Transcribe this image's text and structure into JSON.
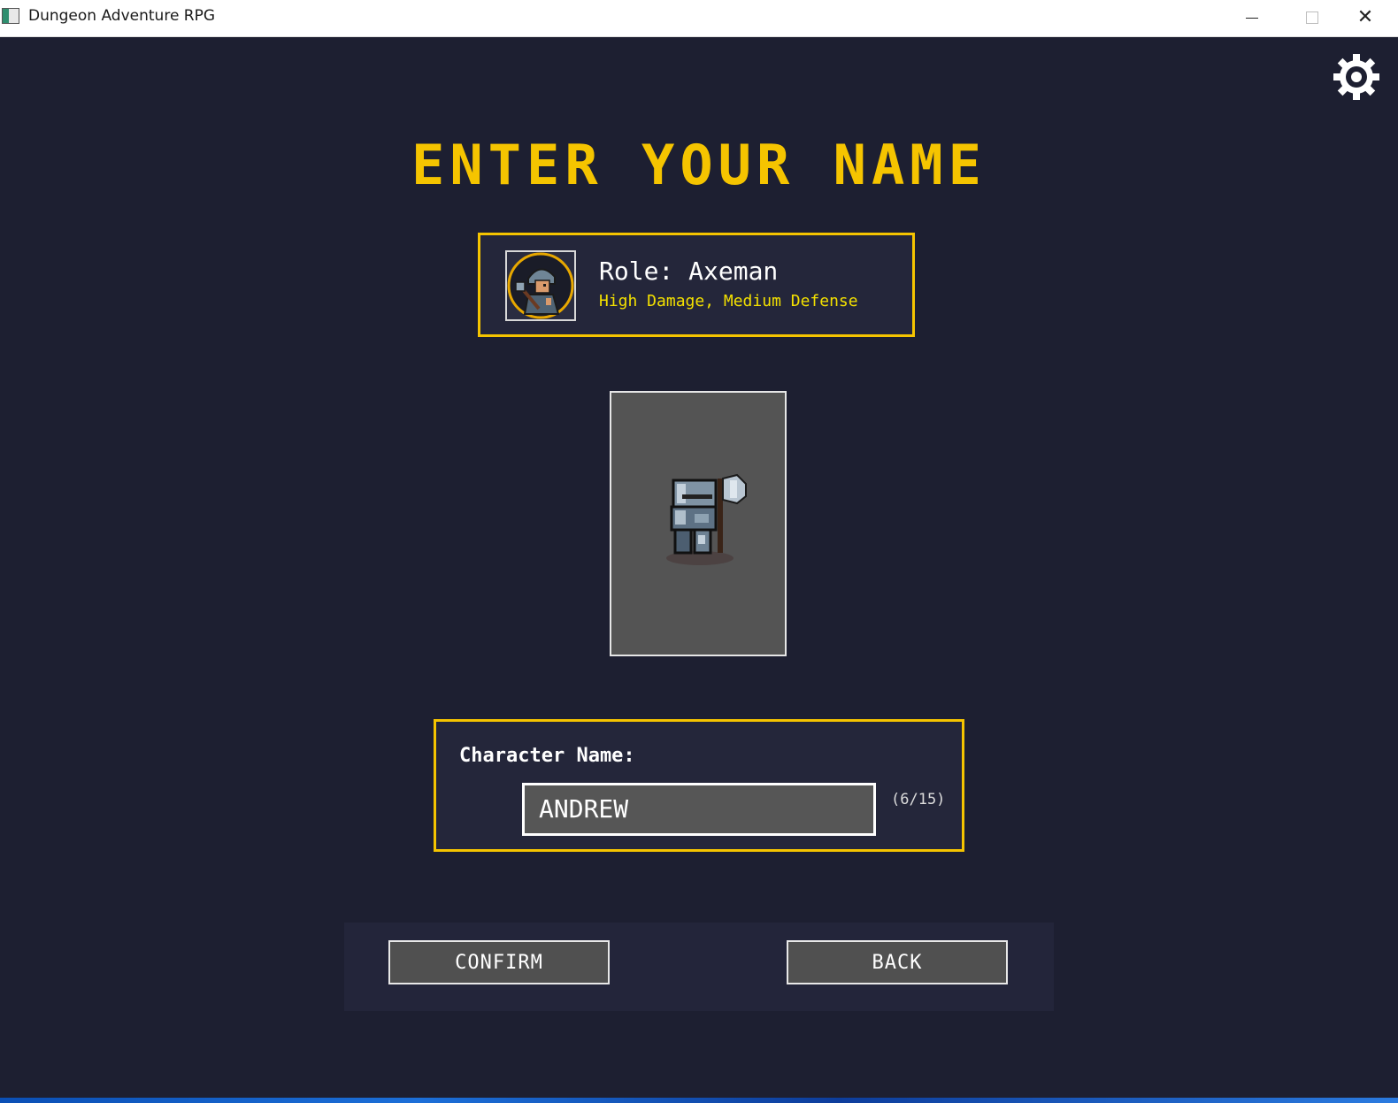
{
  "window": {
    "title": "Dungeon Adventure RPG"
  },
  "icons": {
    "app": "app-icon",
    "settings": "gear-icon",
    "minimize": "minimize-icon",
    "maximize": "maximize-icon",
    "close": "close-icon"
  },
  "screen": {
    "heading": "ENTER YOUR NAME"
  },
  "role": {
    "title": "Role: Axeman",
    "description": "High Damage, Medium Defense"
  },
  "character": {
    "label": "Character Name:",
    "value": "ANDREW",
    "count": "(6/15)"
  },
  "buttons": {
    "confirm": "CONFIRM",
    "back": "BACK"
  },
  "colors": {
    "background": "#1d1f31",
    "accent": "#f5c400",
    "description": "#f3e000",
    "panel": "#24263a"
  }
}
